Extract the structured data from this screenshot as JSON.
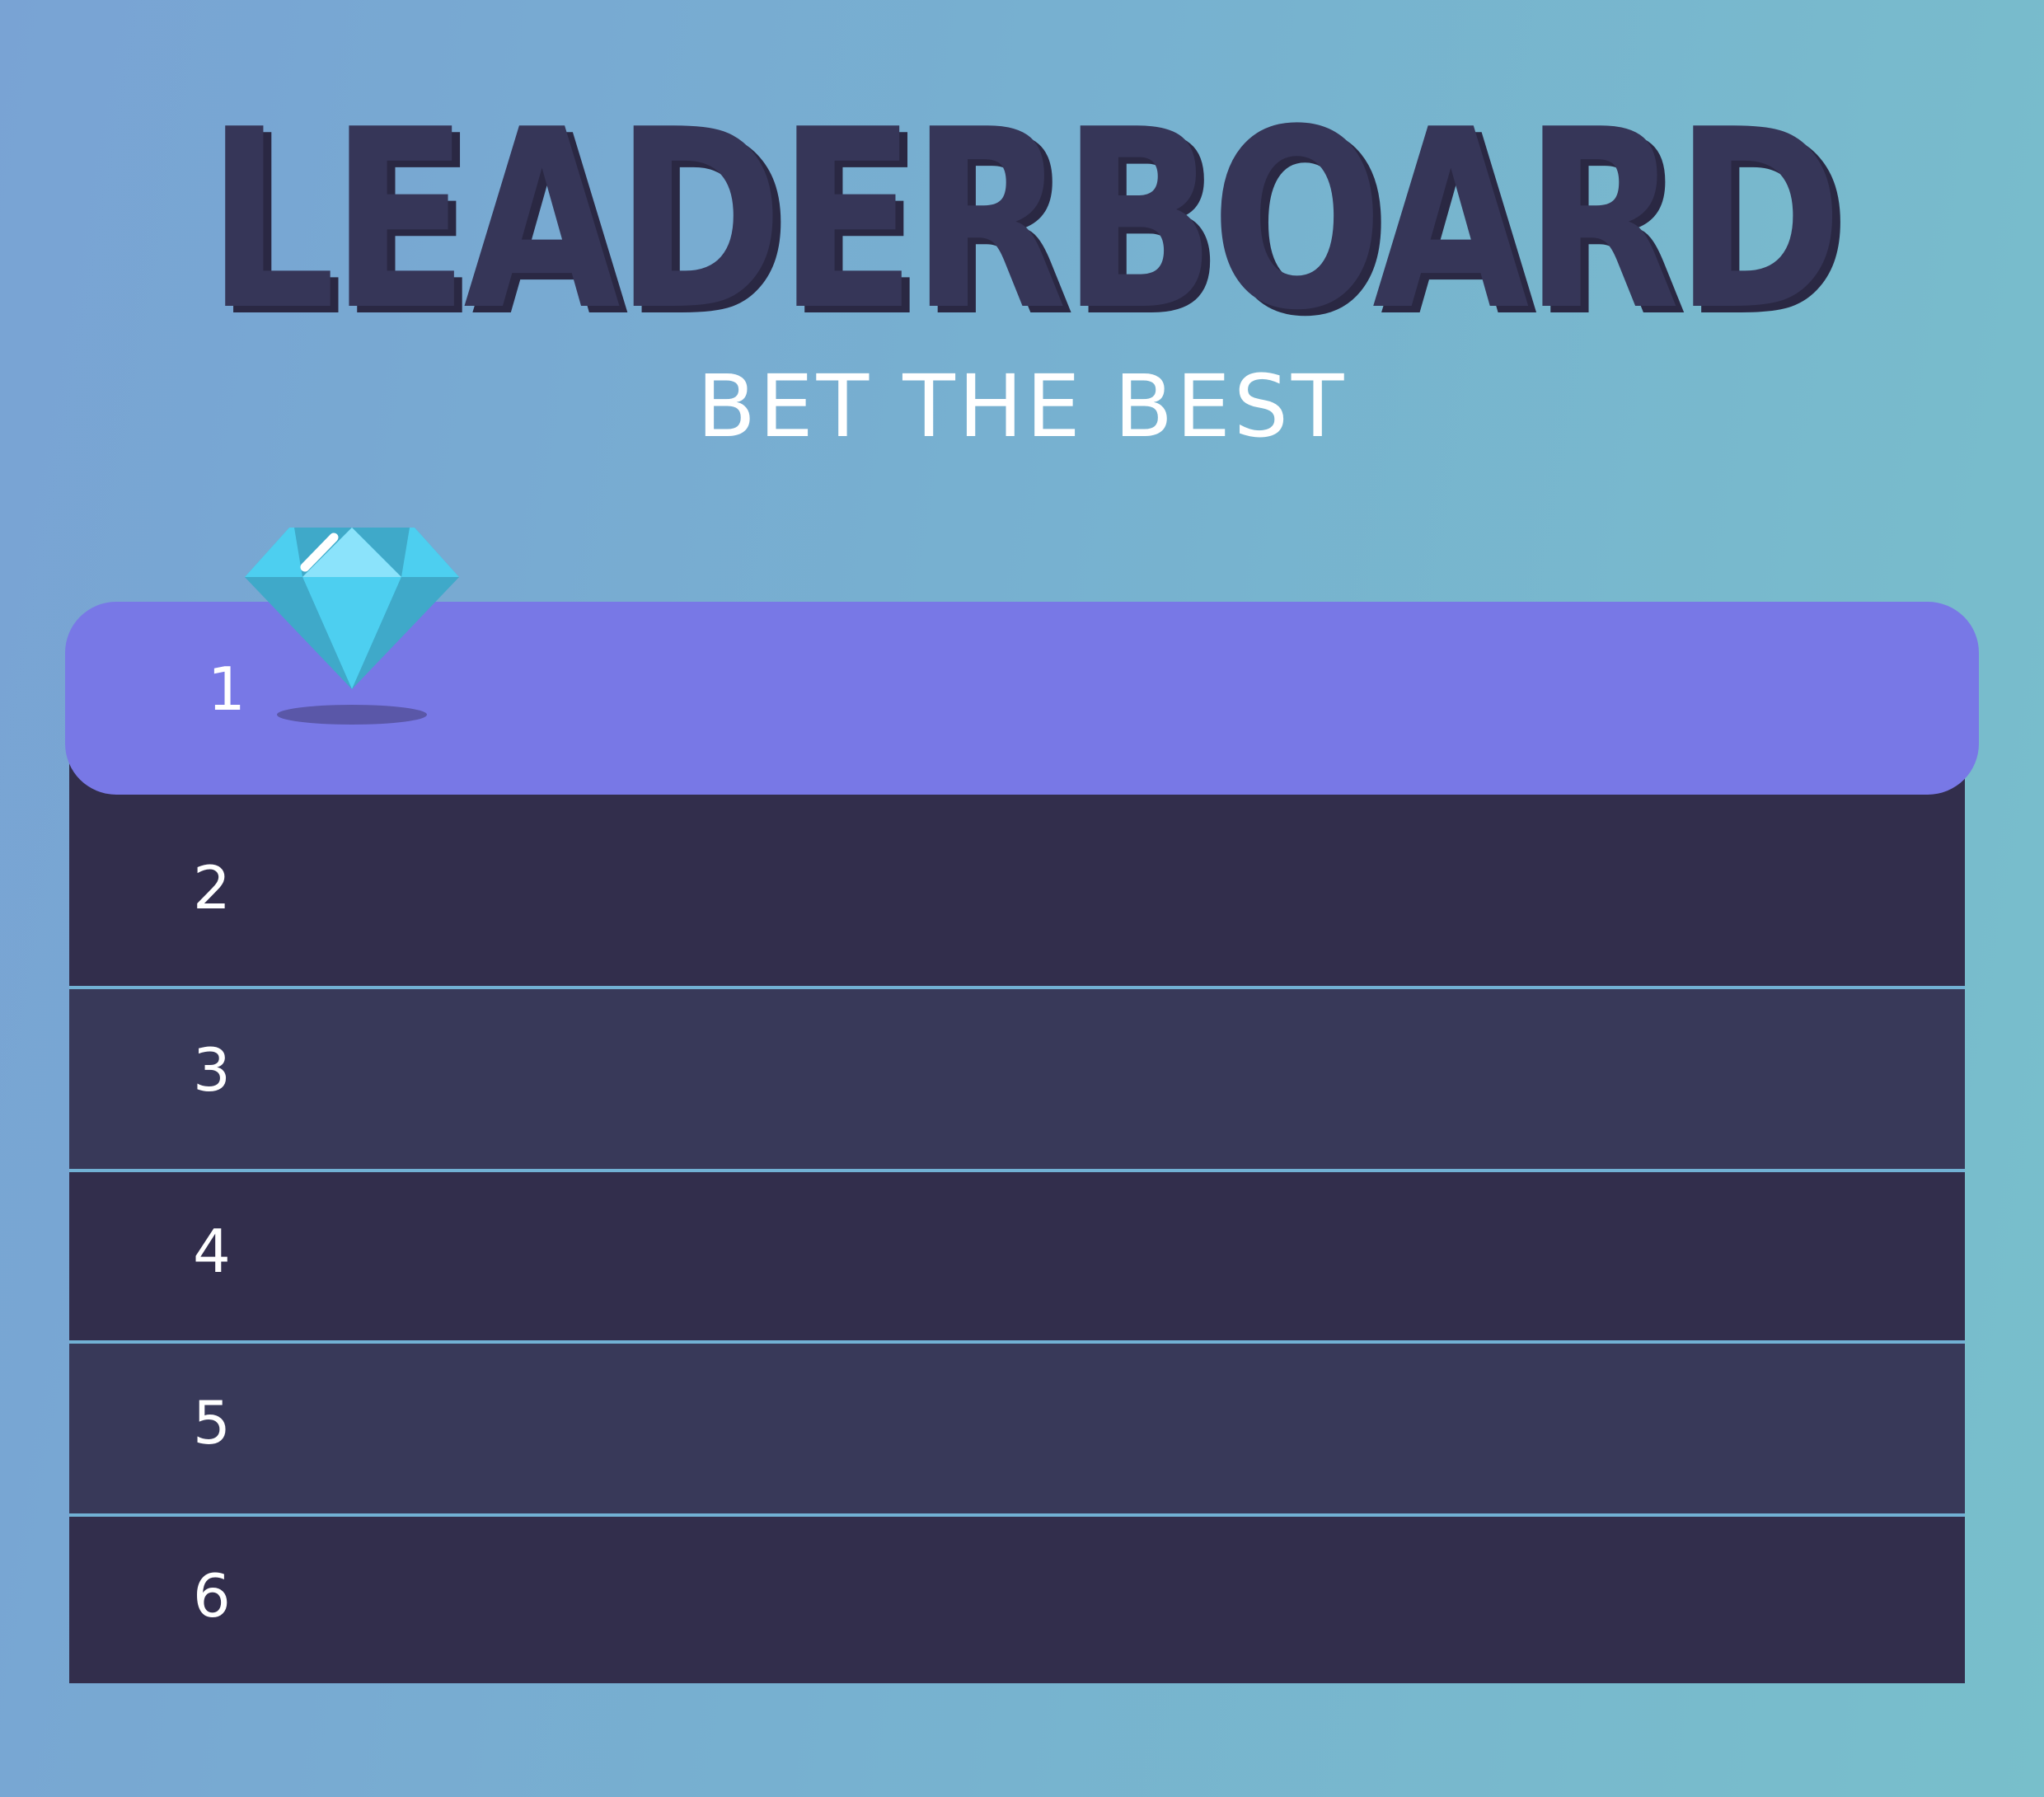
{
  "header": {
    "title": "LEADERBOARD",
    "subtitle": "BET THE BEST"
  },
  "leaderboard": {
    "rows": [
      {
        "rank": "1"
      },
      {
        "rank": "2"
      },
      {
        "rank": "3"
      },
      {
        "rank": "4"
      },
      {
        "rank": "5"
      },
      {
        "rank": "6"
      }
    ],
    "highlight_color": "#7878e6",
    "row_color_dark": "#322e4c",
    "row_color_light": "#383959",
    "separator_color": "#72b1d4"
  },
  "decoration": {
    "icon": "diamond-icon",
    "gem_colors": [
      "#4dcff0",
      "#3fa9c9",
      "#8be3fb"
    ]
  },
  "background": {
    "gradient_colors": [
      "#79a3d4",
      "#78bfcb"
    ]
  }
}
